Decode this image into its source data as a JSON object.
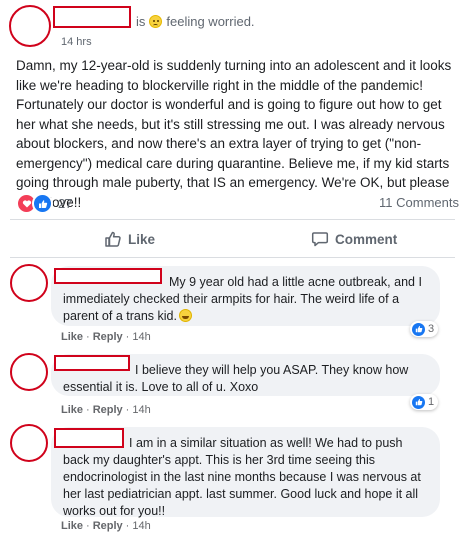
{
  "post": {
    "header_suffix": "is",
    "feeling_text": "feeling worried.",
    "feeling_icon": "worried-face-icon",
    "time": "14 hrs",
    "body": "Damn, my 12-year-old is suddenly turning into an adolescent and it looks like we're heading to blockerville right in the middle of the pandemic! Fortunately our doctor is wonderful and is going to figure out how to get her what she needs, but it's still stressing me out. I was already nervous about blockers, and now there's an extra layer of trying to get (\"non-emergency\") medical care during quarantine. Believe me, if my kid starts going through male puberty, that IS an emergency. We're OK, but please send love!!",
    "reaction_count": "27",
    "comments_count": "11 Comments",
    "reaction_icons": [
      "love-icon",
      "like-icon"
    ]
  },
  "actions": {
    "like_label": "Like",
    "comment_label": "Comment"
  },
  "comments": [
    {
      "text": "My 9 year old had a little acne outbreak, and I immediately checked their armpits for hair. The weird life of a parent of a trans kid.",
      "like_label": "Like",
      "reply_label": "Reply",
      "time": "14h",
      "reaction_count": "3"
    },
    {
      "text": "I believe they will help you ASAP. They know how essential it is. Love to all of u. Xoxo",
      "like_label": "Like",
      "reply_label": "Reply",
      "time": "14h",
      "reaction_count": "1"
    },
    {
      "text": "I am in a similar situation as well! We had to push back my daughter's appt. This is her 3rd time seeing this endocrinologist in the last nine months because I was nervous at her last pediatrician appt. last summer. Good luck and hope it all works out for you!!",
      "like_label": "Like",
      "reply_label": "Reply",
      "time": "14h",
      "reaction_count": ""
    }
  ],
  "colors": {
    "redaction": "#d0021b",
    "bubble": "#f0f2f5",
    "like_blue": "#1877f2",
    "love_red": "#f33e58",
    "meta_gray": "#65676b"
  }
}
